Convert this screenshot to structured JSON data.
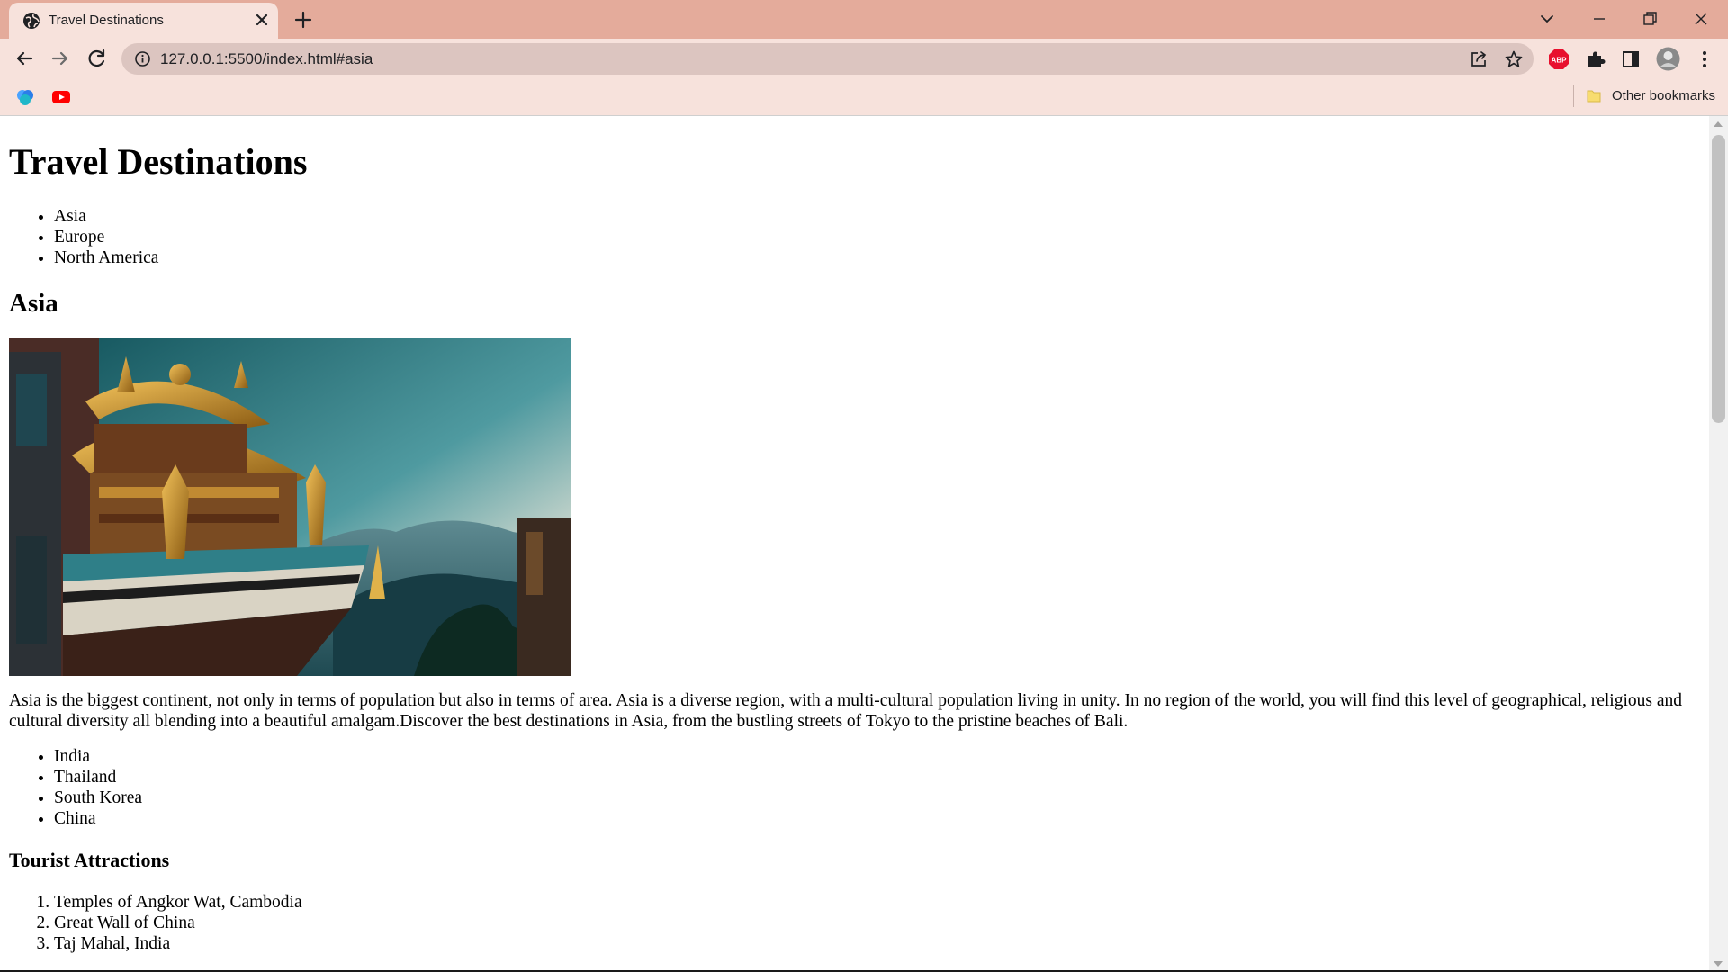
{
  "browser": {
    "tab_title": "Travel Destinations",
    "url": "127.0.0.1:5500/index.html#asia",
    "bookmarks_other": "Other bookmarks",
    "colors": {
      "tabstrip": "#e4ab9b",
      "toolbar": "#f7e2dc",
      "omnibox": "#dcc5c0"
    }
  },
  "page": {
    "title": "Travel Destinations",
    "nav": [
      "Asia",
      "Europe",
      "North America"
    ],
    "section_title": "Asia",
    "description": "Asia is the biggest continent, not only in terms of population but also in terms of area. Asia is a diverse region, with a multi-cultural population living in unity. In no region of the world, you will find this level of geographical, religious and cultural diversity all blending into a beautiful amalgam.Discover the best destinations in Asia, from the bustling streets of Tokyo to the pristine beaches of Bali.",
    "countries": [
      "India",
      "Thailand",
      "South Korea",
      "China"
    ],
    "attractions_title": "Tourist Attractions",
    "attractions": [
      "Temples of Angkor Wat, Cambodia",
      "Great Wall of China",
      "Taj Mahal, India"
    ]
  }
}
